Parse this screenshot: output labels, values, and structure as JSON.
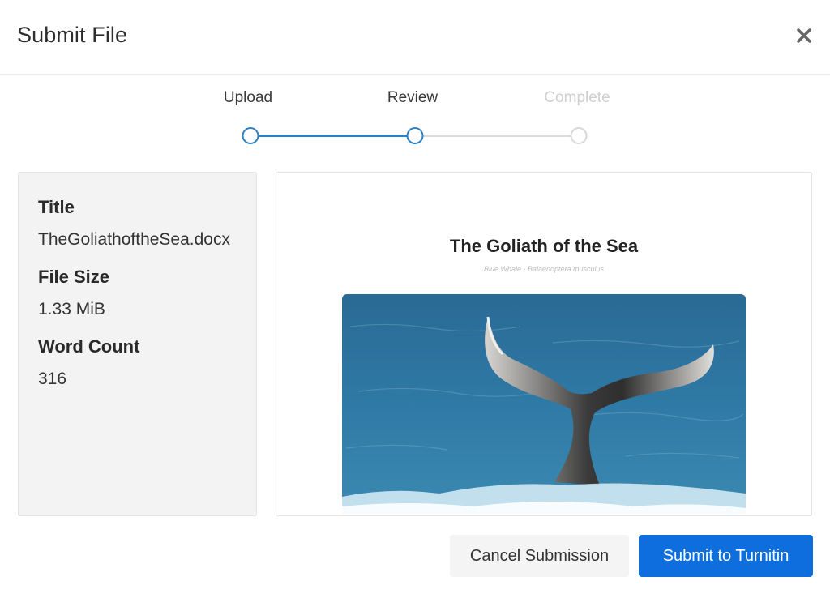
{
  "header": {
    "title": "Submit File"
  },
  "steps": [
    {
      "label": "Upload",
      "state": "done"
    },
    {
      "label": "Review",
      "state": "current"
    },
    {
      "label": "Complete",
      "state": "pending"
    }
  ],
  "info": {
    "title_label": "Title",
    "title_value": "TheGoliathoftheSea.docx",
    "size_label": "File Size",
    "size_value": "1.33 MiB",
    "words_label": "Word Count",
    "words_value": "316"
  },
  "preview": {
    "doc_title": "The Goliath of the Sea",
    "doc_subtitle": "Blue Whale - Balaenoptera musculus",
    "image_icon": "whale-tail-photo"
  },
  "footer": {
    "cancel_label": "Cancel Submission",
    "submit_label": "Submit to Turnitin"
  },
  "colors": {
    "accent": "#2b7fc2",
    "primary_button": "#0e6ede",
    "inactive_step": "#d8d8d8"
  }
}
